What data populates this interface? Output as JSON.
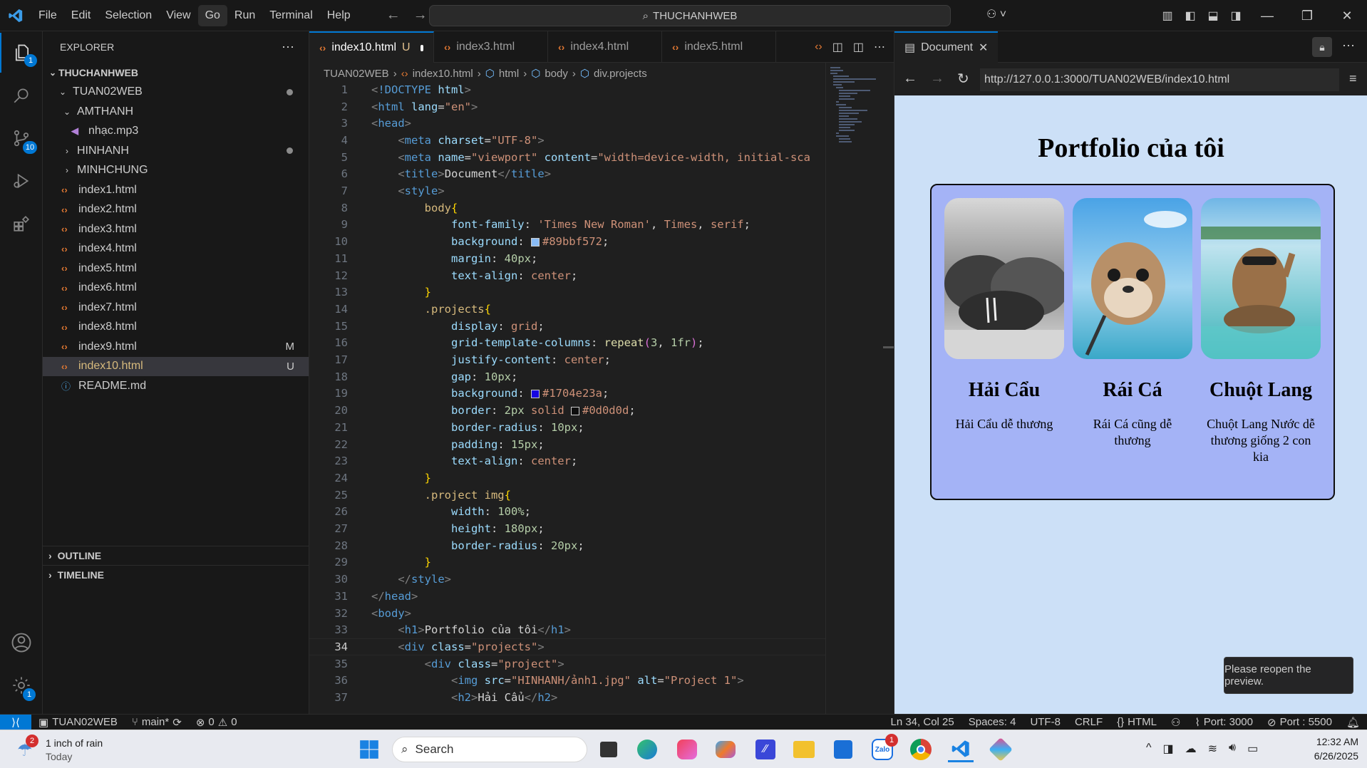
{
  "menu": [
    "File",
    "Edit",
    "Selection",
    "View",
    "Go",
    "Run",
    "Terminal",
    "Help"
  ],
  "command_center": "THUCHANHWEB",
  "explorer": {
    "title": "EXPLORER",
    "root": "THUCHANHWEB",
    "folder": "TUAN02WEB",
    "items": [
      {
        "label": "AMTHANH",
        "type": "folder-open",
        "indent": 2
      },
      {
        "label": "nhạc.mp3",
        "type": "audio",
        "indent": 3
      },
      {
        "label": "HINHANH",
        "type": "folder",
        "indent": 2,
        "dot": true
      },
      {
        "label": "MINHCHUNG",
        "type": "folder",
        "indent": 2
      },
      {
        "label": "index1.html",
        "type": "html",
        "indent": 2
      },
      {
        "label": "index2.html",
        "type": "html",
        "indent": 2
      },
      {
        "label": "index3.html",
        "type": "html",
        "indent": 2
      },
      {
        "label": "index4.html",
        "type": "html",
        "indent": 2
      },
      {
        "label": "index5.html",
        "type": "html",
        "indent": 2
      },
      {
        "label": "index6.html",
        "type": "html",
        "indent": 2
      },
      {
        "label": "index7.html",
        "type": "html",
        "indent": 2
      },
      {
        "label": "index8.html",
        "type": "html",
        "indent": 2
      },
      {
        "label": "index9.html",
        "type": "html",
        "indent": 2,
        "tag": "M"
      },
      {
        "label": "index10.html",
        "type": "html",
        "indent": 2,
        "tag": "U",
        "selected": true
      },
      {
        "label": "README.md",
        "type": "info",
        "indent": 2
      }
    ],
    "outline": "OUTLINE",
    "timeline": "TIMELINE"
  },
  "badges": {
    "explorer": "1",
    "scm": "10",
    "settings": "1"
  },
  "tabs": [
    {
      "label": "index10.html",
      "suffix": "U",
      "active": true
    },
    {
      "label": "index3.html"
    },
    {
      "label": "index4.html"
    },
    {
      "label": "index5.html"
    }
  ],
  "breadcrumb": [
    "TUAN02WEB",
    "index10.html",
    "html",
    "body",
    "div.projects"
  ],
  "code_lines": [
    [
      [
        "t",
        "<"
      ],
      [
        "tg",
        "!DOCTYPE"
      ],
      [
        "at",
        " html"
      ],
      [
        "t",
        ">"
      ]
    ],
    [
      [
        "t",
        "<"
      ],
      [
        "tg",
        "html"
      ],
      [
        "at",
        " lang"
      ],
      [
        "tx",
        "="
      ],
      [
        "st",
        "\"en\""
      ],
      [
        "t",
        ">"
      ]
    ],
    [
      [
        "t",
        "<"
      ],
      [
        "tg",
        "head"
      ],
      [
        "t",
        ">"
      ]
    ],
    [
      [
        "tx",
        "    "
      ],
      [
        "t",
        "<"
      ],
      [
        "tg",
        "meta"
      ],
      [
        "at",
        " charset"
      ],
      [
        "tx",
        "="
      ],
      [
        "st",
        "\"UTF-8\""
      ],
      [
        "t",
        ">"
      ]
    ],
    [
      [
        "tx",
        "    "
      ],
      [
        "t",
        "<"
      ],
      [
        "tg",
        "meta"
      ],
      [
        "at",
        " name"
      ],
      [
        "tx",
        "="
      ],
      [
        "st",
        "\"viewport\""
      ],
      [
        "at",
        " content"
      ],
      [
        "tx",
        "="
      ],
      [
        "st",
        "\"width=device-width, initial-sca"
      ]
    ],
    [
      [
        "tx",
        "    "
      ],
      [
        "t",
        "<"
      ],
      [
        "tg",
        "title"
      ],
      [
        "t",
        ">"
      ],
      [
        "tx",
        "Document"
      ],
      [
        "t",
        "</"
      ],
      [
        "tg",
        "title"
      ],
      [
        "t",
        ">"
      ]
    ],
    [
      [
        "tx",
        "    "
      ],
      [
        "t",
        "<"
      ],
      [
        "tg",
        "style"
      ],
      [
        "t",
        ">"
      ]
    ],
    [
      [
        "tx",
        "        "
      ],
      [
        "sel",
        "body"
      ],
      [
        "br",
        "{"
      ]
    ],
    [
      [
        "tx",
        "            "
      ],
      [
        "pr",
        "font-family"
      ],
      [
        "tx",
        ": "
      ],
      [
        "vl",
        "'Times New Roman'"
      ],
      [
        "tx",
        ", "
      ],
      [
        "vl",
        "Times"
      ],
      [
        "tx",
        ", "
      ],
      [
        "vl",
        "serif"
      ],
      [
        "tx",
        ";"
      ]
    ],
    [
      [
        "tx",
        "            "
      ],
      [
        "pr",
        "background"
      ],
      [
        "tx",
        ": "
      ],
      [
        "sw",
        "#89bbf5"
      ],
      [
        "vl",
        "#89bbf572"
      ],
      [
        "tx",
        ";"
      ]
    ],
    [
      [
        "tx",
        "            "
      ],
      [
        "pr",
        "margin"
      ],
      [
        "tx",
        ": "
      ],
      [
        "nm",
        "40px"
      ],
      [
        "tx",
        ";"
      ]
    ],
    [
      [
        "tx",
        "            "
      ],
      [
        "pr",
        "text-align"
      ],
      [
        "tx",
        ": "
      ],
      [
        "vl",
        "center"
      ],
      [
        "tx",
        ";"
      ]
    ],
    [
      [
        "tx",
        "        "
      ],
      [
        "br",
        "}"
      ]
    ],
    [
      [
        "tx",
        "        "
      ],
      [
        "sel",
        ".projects"
      ],
      [
        "br",
        "{"
      ]
    ],
    [
      [
        "tx",
        "            "
      ],
      [
        "pr",
        "display"
      ],
      [
        "tx",
        ": "
      ],
      [
        "vl",
        "grid"
      ],
      [
        "tx",
        ";"
      ]
    ],
    [
      [
        "tx",
        "            "
      ],
      [
        "pr",
        "grid-template-columns"
      ],
      [
        "tx",
        ": "
      ],
      [
        "fn",
        "repeat"
      ],
      [
        "pk",
        "("
      ],
      [
        "nm",
        "3"
      ],
      [
        "tx",
        ", "
      ],
      [
        "nm",
        "1fr"
      ],
      [
        "pk",
        ")"
      ],
      [
        "tx",
        ";"
      ]
    ],
    [
      [
        "tx",
        "            "
      ],
      [
        "pr",
        "justify-content"
      ],
      [
        "tx",
        ": "
      ],
      [
        "vl",
        "center"
      ],
      [
        "tx",
        ";"
      ]
    ],
    [
      [
        "tx",
        "            "
      ],
      [
        "pr",
        "gap"
      ],
      [
        "tx",
        ": "
      ],
      [
        "nm",
        "10px"
      ],
      [
        "tx",
        ";"
      ]
    ],
    [
      [
        "tx",
        "            "
      ],
      [
        "pr",
        "background"
      ],
      [
        "tx",
        ": "
      ],
      [
        "sw",
        "#1704e2"
      ],
      [
        "vl",
        "#1704e23a"
      ],
      [
        "tx",
        ";"
      ]
    ],
    [
      [
        "tx",
        "            "
      ],
      [
        "pr",
        "border"
      ],
      [
        "tx",
        ": "
      ],
      [
        "nm",
        "2px"
      ],
      [
        "vl",
        " solid "
      ],
      [
        "sw",
        "#0d0d0d"
      ],
      [
        "vl",
        "#0d0d0d"
      ],
      [
        "tx",
        ";"
      ]
    ],
    [
      [
        "tx",
        "            "
      ],
      [
        "pr",
        "border-radius"
      ],
      [
        "tx",
        ": "
      ],
      [
        "nm",
        "10px"
      ],
      [
        "tx",
        ";"
      ]
    ],
    [
      [
        "tx",
        "            "
      ],
      [
        "pr",
        "padding"
      ],
      [
        "tx",
        ": "
      ],
      [
        "nm",
        "15px"
      ],
      [
        "tx",
        ";"
      ]
    ],
    [
      [
        "tx",
        "            "
      ],
      [
        "pr",
        "text-align"
      ],
      [
        "tx",
        ": "
      ],
      [
        "vl",
        "center"
      ],
      [
        "tx",
        ";"
      ]
    ],
    [
      [
        "tx",
        "        "
      ],
      [
        "br",
        "}"
      ]
    ],
    [
      [
        "tx",
        "        "
      ],
      [
        "sel",
        ".project img"
      ],
      [
        "br",
        "{"
      ]
    ],
    [
      [
        "tx",
        "            "
      ],
      [
        "pr",
        "width"
      ],
      [
        "tx",
        ": "
      ],
      [
        "nm",
        "100%"
      ],
      [
        "tx",
        ";"
      ]
    ],
    [
      [
        "tx",
        "            "
      ],
      [
        "pr",
        "height"
      ],
      [
        "tx",
        ": "
      ],
      [
        "nm",
        "180px"
      ],
      [
        "tx",
        ";"
      ]
    ],
    [
      [
        "tx",
        "            "
      ],
      [
        "pr",
        "border-radius"
      ],
      [
        "tx",
        ": "
      ],
      [
        "nm",
        "20px"
      ],
      [
        "tx",
        ";"
      ]
    ],
    [
      [
        "tx",
        "        "
      ],
      [
        "br",
        "}"
      ]
    ],
    [
      [
        "tx",
        "    "
      ],
      [
        "t",
        "</"
      ],
      [
        "tg",
        "style"
      ],
      [
        "t",
        ">"
      ]
    ],
    [
      [
        "t",
        "</"
      ],
      [
        "tg",
        "head"
      ],
      [
        "t",
        ">"
      ]
    ],
    [
      [
        "t",
        "<"
      ],
      [
        "tg",
        "body"
      ],
      [
        "t",
        ">"
      ]
    ],
    [
      [
        "tx",
        "    "
      ],
      [
        "t",
        "<"
      ],
      [
        "tg",
        "h1"
      ],
      [
        "t",
        ">"
      ],
      [
        "tx",
        "Portfolio của tôi"
      ],
      [
        "t",
        "</"
      ],
      [
        "tg",
        "h1"
      ],
      [
        "t",
        ">"
      ]
    ],
    [
      [
        "tx",
        "    "
      ],
      [
        "t",
        "<"
      ],
      [
        "tg",
        "div"
      ],
      [
        "at",
        " class"
      ],
      [
        "tx",
        "="
      ],
      [
        "st",
        "\"projects\""
      ],
      [
        "t",
        ">"
      ]
    ],
    [
      [
        "tx",
        "        "
      ],
      [
        "t",
        "<"
      ],
      [
        "tg",
        "div"
      ],
      [
        "at",
        " class"
      ],
      [
        "tx",
        "="
      ],
      [
        "st",
        "\"project\""
      ],
      [
        "t",
        ">"
      ]
    ],
    [
      [
        "tx",
        "            "
      ],
      [
        "t",
        "<"
      ],
      [
        "tg",
        "img"
      ],
      [
        "at",
        " src"
      ],
      [
        "tx",
        "="
      ],
      [
        "st",
        "\"HINHANH/ảnh1.jpg\""
      ],
      [
        "at",
        " alt"
      ],
      [
        "tx",
        "="
      ],
      [
        "st",
        "\"Project 1\""
      ],
      [
        "t",
        ">"
      ]
    ],
    [
      [
        "tx",
        "            "
      ],
      [
        "t",
        "<"
      ],
      [
        "tg",
        "h2"
      ],
      [
        "t",
        ">"
      ],
      [
        "tx",
        "Hải Cẩu"
      ],
      [
        "t",
        "</"
      ],
      [
        "tg",
        "h2"
      ],
      [
        "t",
        ">"
      ]
    ]
  ],
  "current_line": 34,
  "preview": {
    "tab_label": "Document",
    "url": "http://127.0.0.1:3000/TUAN02WEB/index10.html",
    "heading": "Portfolio của tôi",
    "projects": [
      {
        "title": "Hải Cẩu",
        "desc": "Hải Cẩu dễ thương"
      },
      {
        "title": "Rái Cá",
        "desc": "Rái Cá cũng dễ thương"
      },
      {
        "title": "Chuột Lang",
        "desc": "Chuột Lang Nước dễ thương giống 2 con kia"
      }
    ],
    "toast": "Please reopen the preview."
  },
  "status": {
    "folder": "TUAN02WEB",
    "branch": "main*",
    "errors": "0",
    "warnings": "0",
    "position": "Ln 34, Col 25",
    "spaces": "Spaces: 4",
    "encoding": "UTF-8",
    "eol": "CRLF",
    "language": "HTML",
    "port1": "Port: 3000",
    "port2": "Port : 5500"
  },
  "taskbar": {
    "weather_title": "1 inch of rain",
    "weather_sub": "Today",
    "weather_badge": "2",
    "search": "Search",
    "zalo_badge": "1",
    "time": "12:32 AM",
    "date": "6/26/2025"
  }
}
